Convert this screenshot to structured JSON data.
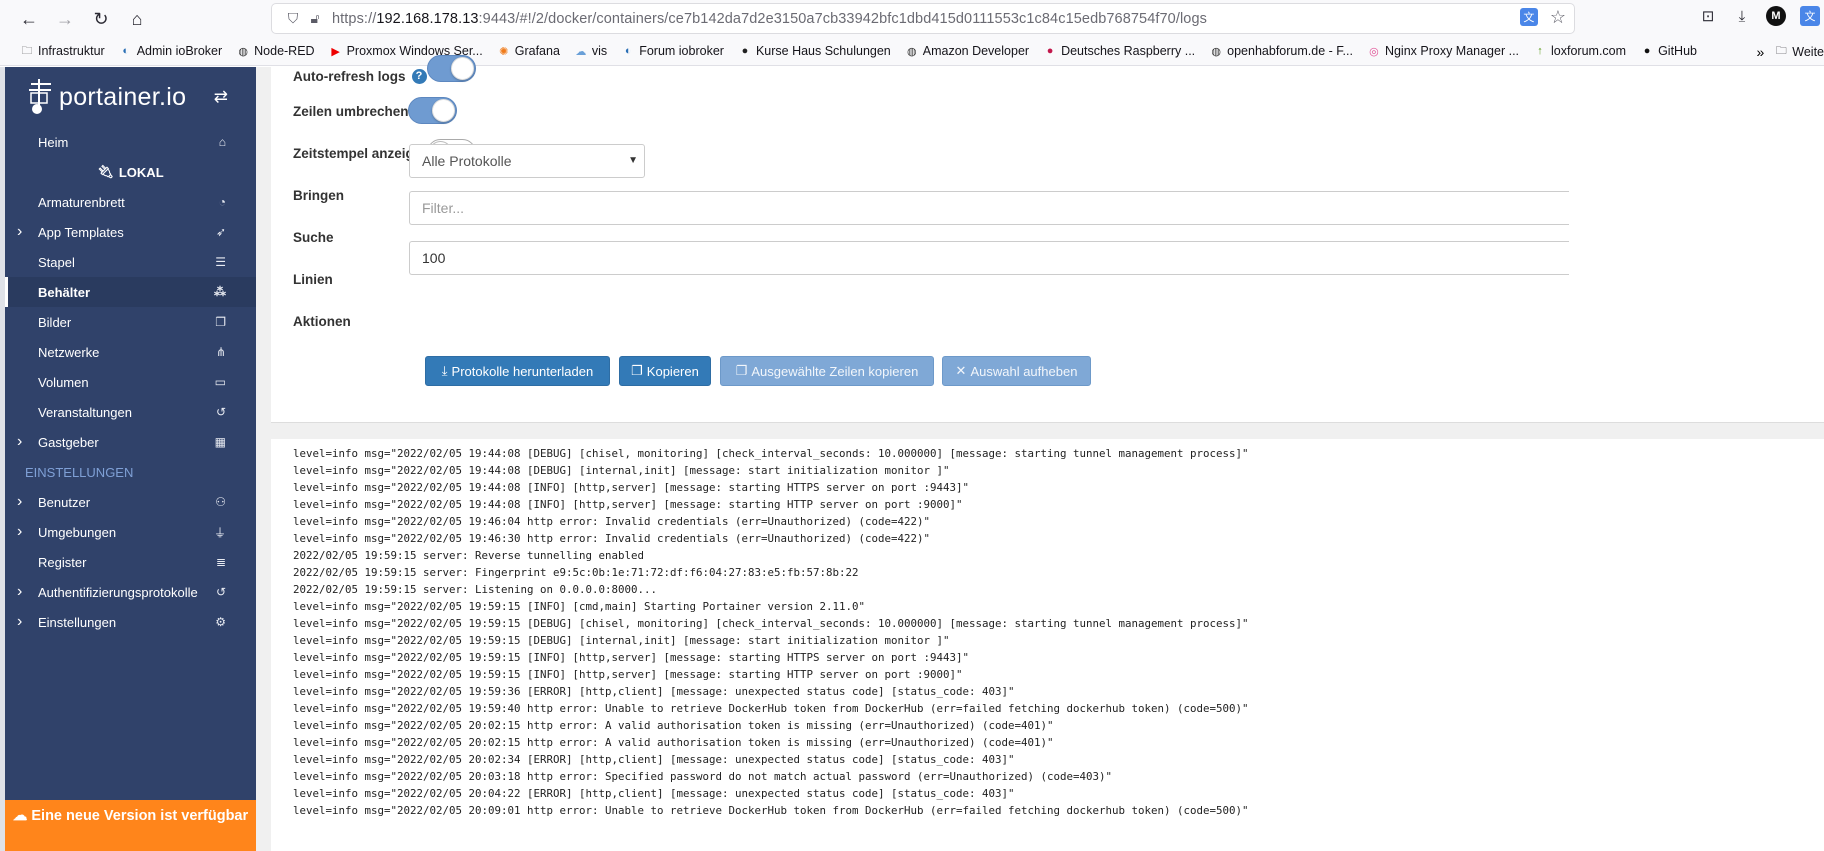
{
  "browser": {
    "url_prefix": "https://",
    "url_host": "192.168.178.13",
    "url_rest": ":9443/#!/2/docker/containers/ce7b142da7d2e3150a7cb33942bfc1dbd415d0111553c1c84c15edb768754f70/logs",
    "avatar_letter": "M",
    "bookmarks": [
      {
        "label": "Infrastruktur",
        "icon": "folder-icon"
      },
      {
        "label": "Admin ioBroker",
        "icon": "iobroker-icon"
      },
      {
        "label": "Node-RED",
        "icon": "globe-icon"
      },
      {
        "label": "Proxmox Windows Ser...",
        "icon": "youtube-icon"
      },
      {
        "label": "Grafana",
        "icon": "grafana-icon"
      },
      {
        "label": "vis",
        "icon": "vis-icon"
      },
      {
        "label": "Forum iobroker",
        "icon": "iobroker-icon"
      },
      {
        "label": "Kurse Haus Schulungen",
        "icon": "kurse-icon"
      },
      {
        "label": "Amazon Developer",
        "icon": "globe-icon"
      },
      {
        "label": "Deutsches Raspberry ...",
        "icon": "raspberry-icon"
      },
      {
        "label": "openhabforum.de - F...",
        "icon": "globe-icon"
      },
      {
        "label": "Nginx Proxy Manager ...",
        "icon": "nginx-icon"
      },
      {
        "label": "loxforum.com",
        "icon": "lox-icon"
      },
      {
        "label": "GitHub",
        "icon": "github-icon"
      }
    ],
    "more_bookmarks": "Weite"
  },
  "sidebar": {
    "logo": "portainer.io",
    "items_top": [
      {
        "label": "Heim",
        "icon": "home-icon",
        "chevron": false
      }
    ],
    "env_label": "LOKAL",
    "items_env": [
      {
        "label": "Armaturenbrett",
        "icon": "tachometer-icon",
        "chevron": false,
        "active": false
      },
      {
        "label": "App Templates",
        "icon": "rocket-icon",
        "chevron": true,
        "active": false
      },
      {
        "label": "Stapel",
        "icon": "list-icon",
        "chevron": false,
        "active": false
      },
      {
        "label": "Behälter",
        "icon": "cubes-icon",
        "chevron": false,
        "active": true
      },
      {
        "label": "Bilder",
        "icon": "clone-icon",
        "chevron": false,
        "active": false
      },
      {
        "label": "Netzwerke",
        "icon": "sitemap-icon",
        "chevron": false,
        "active": false
      },
      {
        "label": "Volumen",
        "icon": "hdd-icon",
        "chevron": false,
        "active": false
      },
      {
        "label": "Veranstaltungen",
        "icon": "history-icon",
        "chevron": false,
        "active": false
      },
      {
        "label": "Gastgeber",
        "icon": "th-icon",
        "chevron": true,
        "active": false
      }
    ],
    "settings_section": "EINSTELLUNGEN",
    "items_settings": [
      {
        "label": "Benutzer",
        "icon": "users-icon",
        "chevron": true
      },
      {
        "label": "Umgebungen",
        "icon": "plug-icon",
        "chevron": true
      },
      {
        "label": "Register",
        "icon": "database-icon",
        "chevron": false
      },
      {
        "label": "Authentifizierungsprotokolle",
        "icon": "history-icon",
        "chevron": true
      },
      {
        "label": "Einstellungen",
        "icon": "cogs-icon",
        "chevron": true
      }
    ],
    "update_banner": "Eine neue Version ist verfügbar"
  },
  "settings": {
    "auto_refresh_label": "Auto-refresh logs",
    "auto_refresh_on": true,
    "wrap_label": "Zeilen umbrechen",
    "wrap_on": true,
    "timestamp_label": "Zeitstempel anzeigen",
    "timestamp_on": false,
    "fetch_label": "Bringen",
    "fetch_value": "Alle Protokolle",
    "search_label": "Suche",
    "search_placeholder": "Filter...",
    "lines_label": "Linien",
    "lines_value": "100",
    "actions_label": "Aktionen",
    "btn_download": "Protokolle herunterladen",
    "btn_copy": "Kopieren",
    "btn_copy_selected": "Ausgewählte Zeilen kopieren",
    "btn_clear_selection": "Auswahl aufheben"
  },
  "logs": [
    "level=info msg=\"2022/02/05 19:44:08 [DEBUG] [chisel, monitoring] [check_interval_seconds: 10.000000] [message: starting tunnel management process]\"",
    "level=info msg=\"2022/02/05 19:44:08 [DEBUG] [internal,init] [message: start initialization monitor ]\"",
    "level=info msg=\"2022/02/05 19:44:08 [INFO] [http,server] [message: starting HTTPS server on port :9443]\"",
    "level=info msg=\"2022/02/05 19:44:08 [INFO] [http,server] [message: starting HTTP server on port :9000]\"",
    "level=info msg=\"2022/02/05 19:46:04 http error: Invalid credentials (err=Unauthorized) (code=422)\"",
    "level=info msg=\"2022/02/05 19:46:30 http error: Invalid credentials (err=Unauthorized) (code=422)\"",
    "2022/02/05 19:59:15 server: Reverse tunnelling enabled",
    "2022/02/05 19:59:15 server: Fingerprint e9:5c:0b:1e:71:72:df:f6:04:27:83:e5:fb:57:8b:22",
    "2022/02/05 19:59:15 server: Listening on 0.0.0.0:8000...",
    "level=info msg=\"2022/02/05 19:59:15 [INFO] [cmd,main] Starting Portainer version 2.11.0\"",
    "level=info msg=\"2022/02/05 19:59:15 [DEBUG] [chisel, monitoring] [check_interval_seconds: 10.000000] [message: starting tunnel management process]\"",
    "level=info msg=\"2022/02/05 19:59:15 [DEBUG] [internal,init] [message: start initialization monitor ]\"",
    "level=info msg=\"2022/02/05 19:59:15 [INFO] [http,server] [message: starting HTTPS server on port :9443]\"",
    "level=info msg=\"2022/02/05 19:59:15 [INFO] [http,server] [message: starting HTTP server on port :9000]\"",
    "level=info msg=\"2022/02/05 19:59:36 [ERROR] [http,client] [message: unexpected status code] [status_code: 403]\"",
    "level=info msg=\"2022/02/05 19:59:40 http error: Unable to retrieve DockerHub token from DockerHub (err=failed fetching dockerhub token) (code=500)\"",
    "level=info msg=\"2022/02/05 20:02:15 http error: A valid authorisation token is missing (err=Unauthorized) (code=401)\"",
    "level=info msg=\"2022/02/05 20:02:15 http error: A valid authorisation token is missing (err=Unauthorized) (code=401)\"",
    "level=info msg=\"2022/02/05 20:02:34 [ERROR] [http,client] [message: unexpected status code] [status_code: 403]\"",
    "level=info msg=\"2022/02/05 20:03:18 http error: Specified password do not match actual password (err=Unauthorized) (code=403)\"",
    "level=info msg=\"2022/02/05 20:04:22 [ERROR] [http,client] [message: unexpected status code] [status_code: 403]\"",
    "level=info msg=\"2022/02/05 20:09:01 http error: Unable to retrieve DockerHub token from DockerHub (err=failed fetching dockerhub token) (code=500)\""
  ]
}
